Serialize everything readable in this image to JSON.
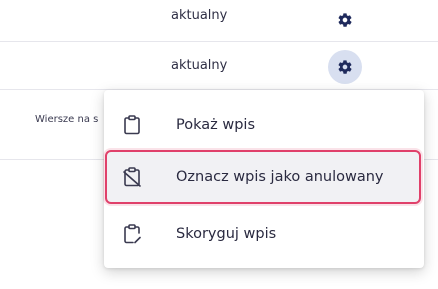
{
  "table": {
    "rows": [
      {
        "status": "aktualny",
        "actions_icon": "gear-icon"
      },
      {
        "status": "aktualny",
        "actions_icon": "gear-icon"
      }
    ],
    "footer": {
      "rows_per_page_label": "Wiersze na s"
    }
  },
  "menu": {
    "items": [
      {
        "label": "Pokaż wpis",
        "icon": "clipboard-icon"
      },
      {
        "label": "Oznacz wpis jako anulowany",
        "icon": "clipboard-cancel-icon",
        "highlighted": true
      },
      {
        "label": "Skoryguj wpis",
        "icon": "clipboard-edit-icon"
      }
    ]
  },
  "colors": {
    "accent": "#1f2a5c",
    "highlight_border": "#e0406a",
    "active_gear_bg": "#d8dff0"
  }
}
